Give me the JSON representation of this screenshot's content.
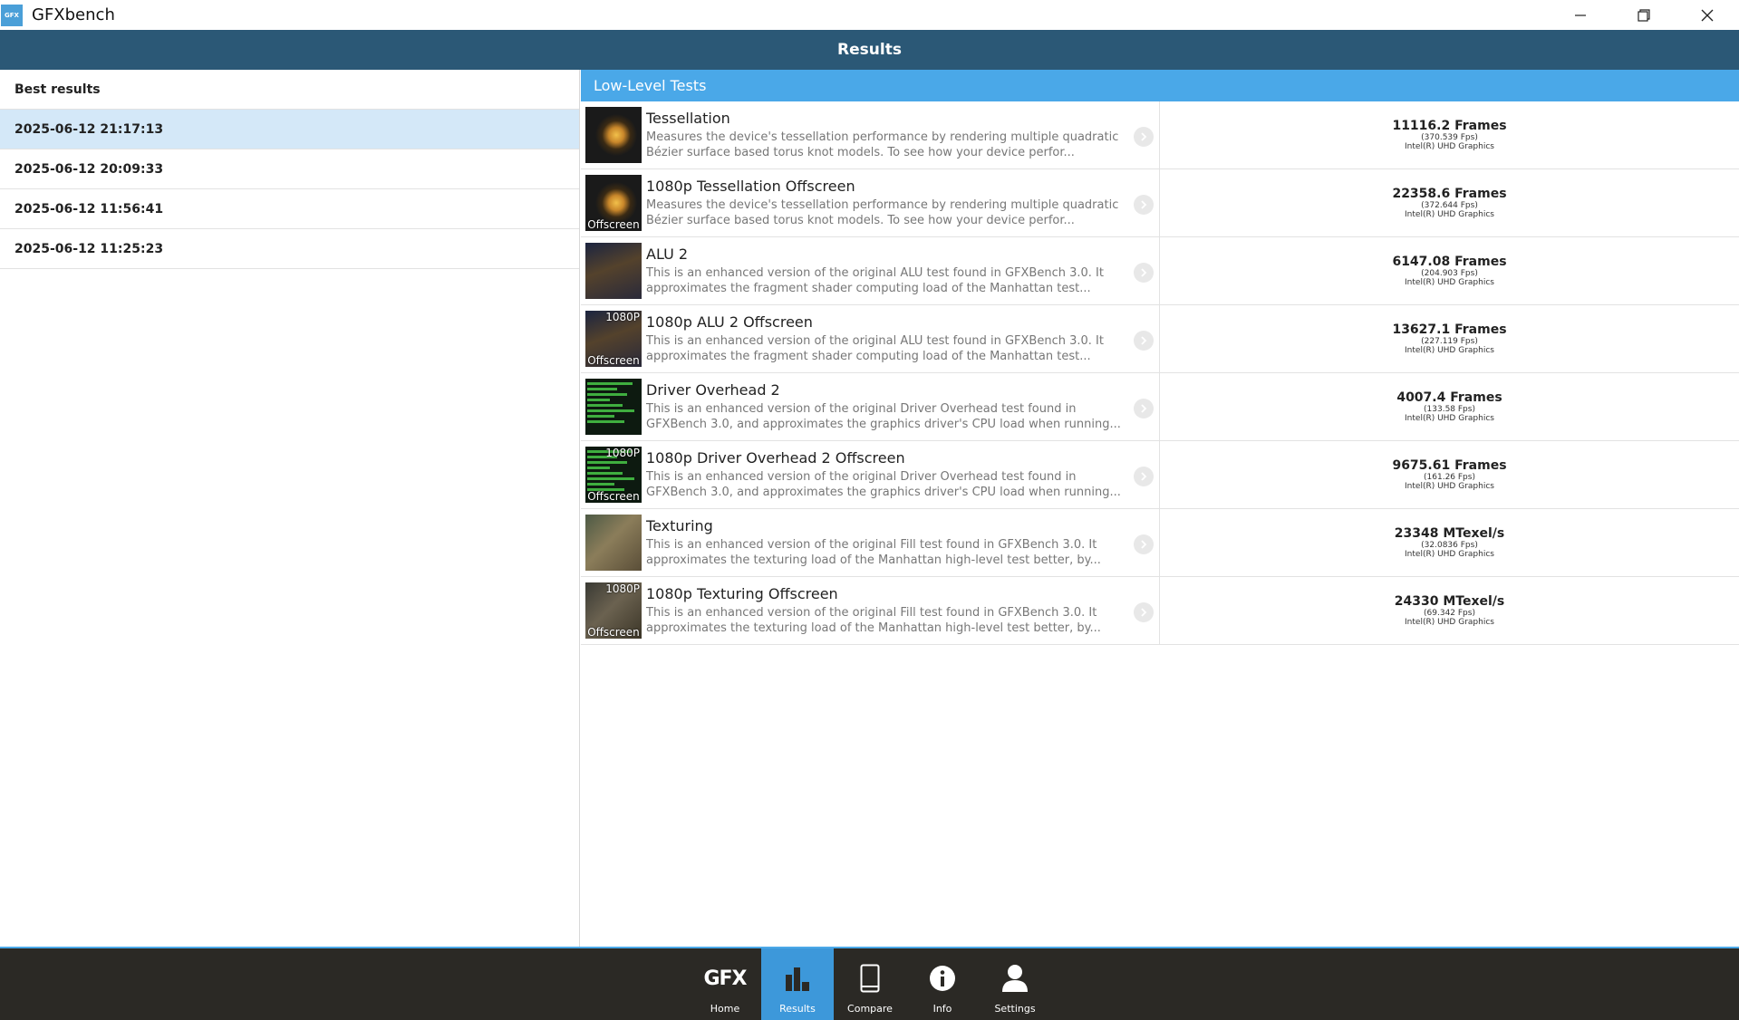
{
  "window": {
    "logo_text": "GFX",
    "title": "GFXbench"
  },
  "header": {
    "title": "Results"
  },
  "left_panel": {
    "heading": "Best results",
    "dates": [
      {
        "label": "2025-06-12 21:17:13",
        "selected": true
      },
      {
        "label": "2025-06-12 20:09:33",
        "selected": false
      },
      {
        "label": "2025-06-12 11:56:41",
        "selected": false
      },
      {
        "label": "2025-06-12 11:25:23",
        "selected": false
      }
    ]
  },
  "right_panel": {
    "section_title": "Low-Level Tests",
    "tests": [
      {
        "name": "Tessellation",
        "desc": "Measures the device's tessellation performance by rendering multiple quadratic Bézier surface based torus knot models. To see how your device perfor...",
        "score": "11116.2 Frames",
        "fps": "(370.539 Fps)",
        "gpu": "Intel(R) UHD Graphics",
        "thumb": "tessellation",
        "tag_top": "",
        "tag_bottom": ""
      },
      {
        "name": "1080p Tessellation Offscreen",
        "desc": "Measures the device's tessellation performance by rendering multiple quadratic Bézier surface based torus knot models. To see how your device perfor...",
        "score": "22358.6 Frames",
        "fps": "(372.644 Fps)",
        "gpu": "Intel(R) UHD Graphics",
        "thumb": "tessellation",
        "tag_top": "",
        "tag_bottom": "Offscreen"
      },
      {
        "name": "ALU 2",
        "desc": "This is an enhanced version of the original ALU test found in GFXBench 3.0. It approximates the fragment shader computing load of the Manhattan test...",
        "score": "6147.08 Frames",
        "fps": "(204.903 Fps)",
        "gpu": "Intel(R) UHD Graphics",
        "thumb": "alu",
        "tag_top": "",
        "tag_bottom": ""
      },
      {
        "name": "1080p ALU 2 Offscreen",
        "desc": "This is an enhanced version of the original ALU test found in GFXBench 3.0. It approximates the fragment shader computing load of the Manhattan test...",
        "score": "13627.1 Frames",
        "fps": "(227.119 Fps)",
        "gpu": "Intel(R) UHD Graphics",
        "thumb": "alu",
        "tag_top": "1080P",
        "tag_bottom": "Offscreen"
      },
      {
        "name": "Driver Overhead 2",
        "desc": "This is an enhanced version of the original Driver Overhead test found in GFXBench 3.0, and approximates the graphics driver's CPU load when running...",
        "score": "4007.4 Frames",
        "fps": "(133.58 Fps)",
        "gpu": "Intel(R) UHD Graphics",
        "thumb": "driver",
        "tag_top": "",
        "tag_bottom": ""
      },
      {
        "name": "1080p Driver Overhead 2 Offscreen",
        "desc": "This is an enhanced version of the original Driver Overhead test found in GFXBench 3.0, and approximates the graphics driver's CPU load when running...",
        "score": "9675.61 Frames",
        "fps": "(161.26 Fps)",
        "gpu": "Intel(R) UHD Graphics",
        "thumb": "driver",
        "tag_top": "1080P",
        "tag_bottom": "Offscreen"
      },
      {
        "name": "Texturing",
        "desc": "This is an enhanced version of the original Fill test found in GFXBench 3.0. It approximates the texturing load of the Manhattan high-level test better, by...",
        "score": "23348 MTexel/s",
        "fps": "(32.0836 Fps)",
        "gpu": "Intel(R) UHD Graphics",
        "thumb": "texturing",
        "tag_top": "",
        "tag_bottom": ""
      },
      {
        "name": "1080p Texturing Offscreen",
        "desc": "This is an enhanced version of the original Fill test found in GFXBench 3.0. It approximates the texturing load of the Manhattan high-level test better, by...",
        "score": "24330 MTexel/s",
        "fps": "(69.342 Fps)",
        "gpu": "Intel(R) UHD Graphics",
        "thumb": "texturing-dark",
        "tag_top": "1080P",
        "tag_bottom": "Offscreen"
      }
    ]
  },
  "nav": {
    "items": [
      {
        "label": "Home",
        "icon": "gfx-logo-icon",
        "icon_text": "GFX",
        "active": false
      },
      {
        "label": "Results",
        "icon": "bar-chart-icon",
        "active": true
      },
      {
        "label": "Compare",
        "icon": "phone-icon",
        "active": false
      },
      {
        "label": "Info",
        "icon": "info-icon",
        "active": false
      },
      {
        "label": "Settings",
        "icon": "user-icon",
        "active": false
      }
    ]
  },
  "colors": {
    "header_bg": "#2b5876",
    "section_bg": "#4aa8e8",
    "selected_row": "#d4e8f8",
    "navbar_bg": "#2b2925",
    "nav_active": "#3d98da"
  }
}
